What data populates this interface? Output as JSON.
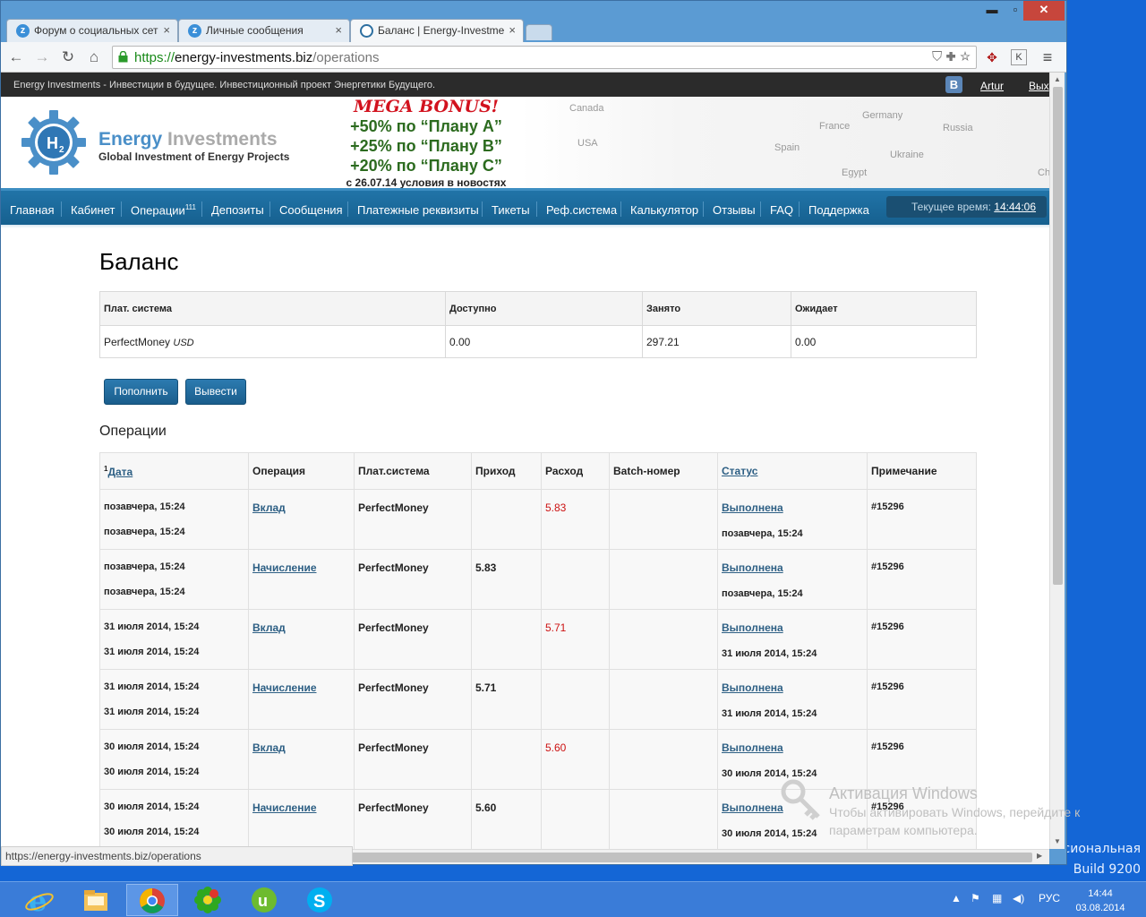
{
  "desktop": {
    "text_line1": "сиональная",
    "text_line2": "Build 9200"
  },
  "browser": {
    "tabs": [
      {
        "label": "Форум о социальных сет",
        "icon": "z-icon"
      },
      {
        "label": "Личные сообщения",
        "icon": "z-icon"
      },
      {
        "label": "Баланс | Energy-Investme",
        "icon": "h2-icon"
      }
    ],
    "url_scheme": "https://",
    "url_host": "energy-investments.biz",
    "url_path": "/operations",
    "status_url": "https://energy-investments.biz/operations"
  },
  "site": {
    "top_strip": "Energy Investments - Инвестиции в будущее. Инвестиционный проект Энергетики Будущего.",
    "vk_label": "В",
    "user": "Artur",
    "exit": "Вых",
    "brand_energy": "Energy",
    "brand_investments": "Investments",
    "brand_tagline": "Global Investment of Energy Projects",
    "logo_text": "H2",
    "bonus": {
      "title": "MEGA BONUS!",
      "line1": "+50% по “Плану А”",
      "line2": "+25% по “Плану В”",
      "line3": "+20% по “Плану С”",
      "date": "с 26.07.14 условия в новостях"
    },
    "map_labels": [
      "Canada",
      "USA",
      "Germany",
      "France",
      "Russia",
      "Spain",
      "Ukraine",
      "Egypt",
      "Ch"
    ],
    "nav": [
      "Главная",
      "Кабинет",
      "Операции",
      "Депозиты",
      "Сообщения",
      "Платежные реквизиты",
      "Тикеты",
      "Реф.система",
      "Калькулятор",
      "Отзывы",
      "FAQ",
      "Поддержка"
    ],
    "nav_ops_badge": "111",
    "clock_label": "Текущее время:",
    "clock_time": "14:44:06"
  },
  "balance": {
    "title": "Баланс",
    "headers": [
      "Плат. система",
      "Доступно",
      "Занято",
      "Ожидает"
    ],
    "row": {
      "system": "PerfectMoney",
      "currency": "USD",
      "available": "0.00",
      "busy": "297.21",
      "pending": "0.00"
    },
    "btn_deposit": "Пополнить",
    "btn_withdraw": "Вывести"
  },
  "operations": {
    "title": "Операции",
    "sort_mark": "1",
    "headers": [
      "Дата",
      "Операция",
      "Плат.система",
      "Приход",
      "Расход",
      "Batch-номер",
      "Статус",
      "Примечание"
    ],
    "rows": [
      {
        "date1": "позавчера, 15:24",
        "date2": "позавчера, 15:24",
        "op": "Вклад",
        "system": "PerfectMoney",
        "income": "",
        "expense": "5.83",
        "batch": "",
        "status": "Выполнена",
        "status_date": "позавчера, 15:24",
        "note": "#15296"
      },
      {
        "date1": "позавчера, 15:24",
        "date2": "позавчера, 15:24",
        "op": "Начисление",
        "system": "PerfectMoney",
        "income": "5.83",
        "expense": "",
        "batch": "",
        "status": "Выполнена",
        "status_date": "позавчера, 15:24",
        "note": "#15296"
      },
      {
        "date1": "31 июля 2014, 15:24",
        "date2": "31 июля 2014, 15:24",
        "op": "Вклад",
        "system": "PerfectMoney",
        "income": "",
        "expense": "5.71",
        "batch": "",
        "status": "Выполнена",
        "status_date": "31 июля 2014, 15:24",
        "note": "#15296"
      },
      {
        "date1": "31 июля 2014, 15:24",
        "date2": "31 июля 2014, 15:24",
        "op": "Начисление",
        "system": "PerfectMoney",
        "income": "5.71",
        "expense": "",
        "batch": "",
        "status": "Выполнена",
        "status_date": "31 июля 2014, 15:24",
        "note": "#15296"
      },
      {
        "date1": "30 июля 2014, 15:24",
        "date2": "30 июля 2014, 15:24",
        "op": "Вклад",
        "system": "PerfectMoney",
        "income": "",
        "expense": "5.60",
        "batch": "",
        "status": "Выполнена",
        "status_date": "30 июля 2014, 15:24",
        "note": "#15296"
      },
      {
        "date1": "30 июля 2014, 15:24",
        "date2": "30 июля 2014, 15:24",
        "op": "Начисление",
        "system": "PerfectMoney",
        "income": "5.60",
        "expense": "",
        "batch": "",
        "status": "Выполнена",
        "status_date": "30 июля 2014, 15:24",
        "note": "#15296"
      }
    ]
  },
  "watermark": {
    "title": "Активация Windows",
    "line1": "Чтобы активировать Windows, перейдите к",
    "line2": "параметрам компьютера."
  },
  "taskbar": {
    "apps": [
      "internet-explorer-icon",
      "file-explorer-icon",
      "chrome-icon",
      "icq-icon",
      "utorrent-icon",
      "skype-icon"
    ],
    "lang": "РУС",
    "time": "14:44",
    "date": "03.08.2014"
  },
  "colors": {
    "nav": "#1a6496",
    "expense": "#cc1111",
    "link": "#2d5f84",
    "bonus_red": "#d2121e",
    "bonus_green": "#2c6b1f"
  }
}
